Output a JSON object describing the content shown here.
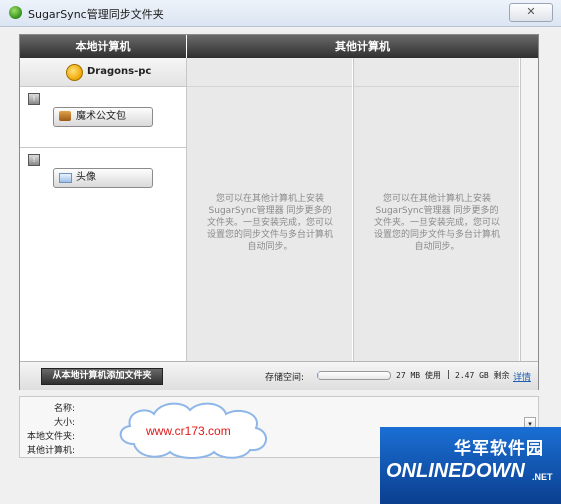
{
  "window": {
    "title": "SugarSync管理同步文件夹",
    "close_label": "✕"
  },
  "local": {
    "header": "本地计算机",
    "computer_name": "Dragons-pc",
    "folders": [
      {
        "label": "魔术公文包"
      },
      {
        "label": "头像"
      }
    ],
    "add_button": "从本地计算机添加文件夹"
  },
  "other": {
    "header": "其他计算机",
    "panes": [
      {
        "text": "您可以在其他计算机上安装SugarSync管理器 同步更多的文件夹。一旦安装完成，您可以设置您的同步文件与多台计算机自动同步。"
      },
      {
        "text": "您可以在其他计算机上安装SugarSync管理器 同步更多的文件夹。一旦安装完成，您可以设置您的同步文件与多台计算机自动同步。"
      }
    ]
  },
  "storage": {
    "label": "存储空间:",
    "used": "27 MB 使用",
    "separator": "|",
    "free": "2.47 GB 剩余",
    "detail_link": "详情",
    "used_fraction": 0.01
  },
  "info": {
    "labels": [
      "名称:",
      "大小:",
      "本地文件夹:",
      "其他计算机:"
    ]
  },
  "watermark": {
    "url_text": "www.cr173.com",
    "brand_cn": "华军软件园",
    "brand_en": "ONLINEDOWN",
    "brand_suffix": ".NET"
  }
}
